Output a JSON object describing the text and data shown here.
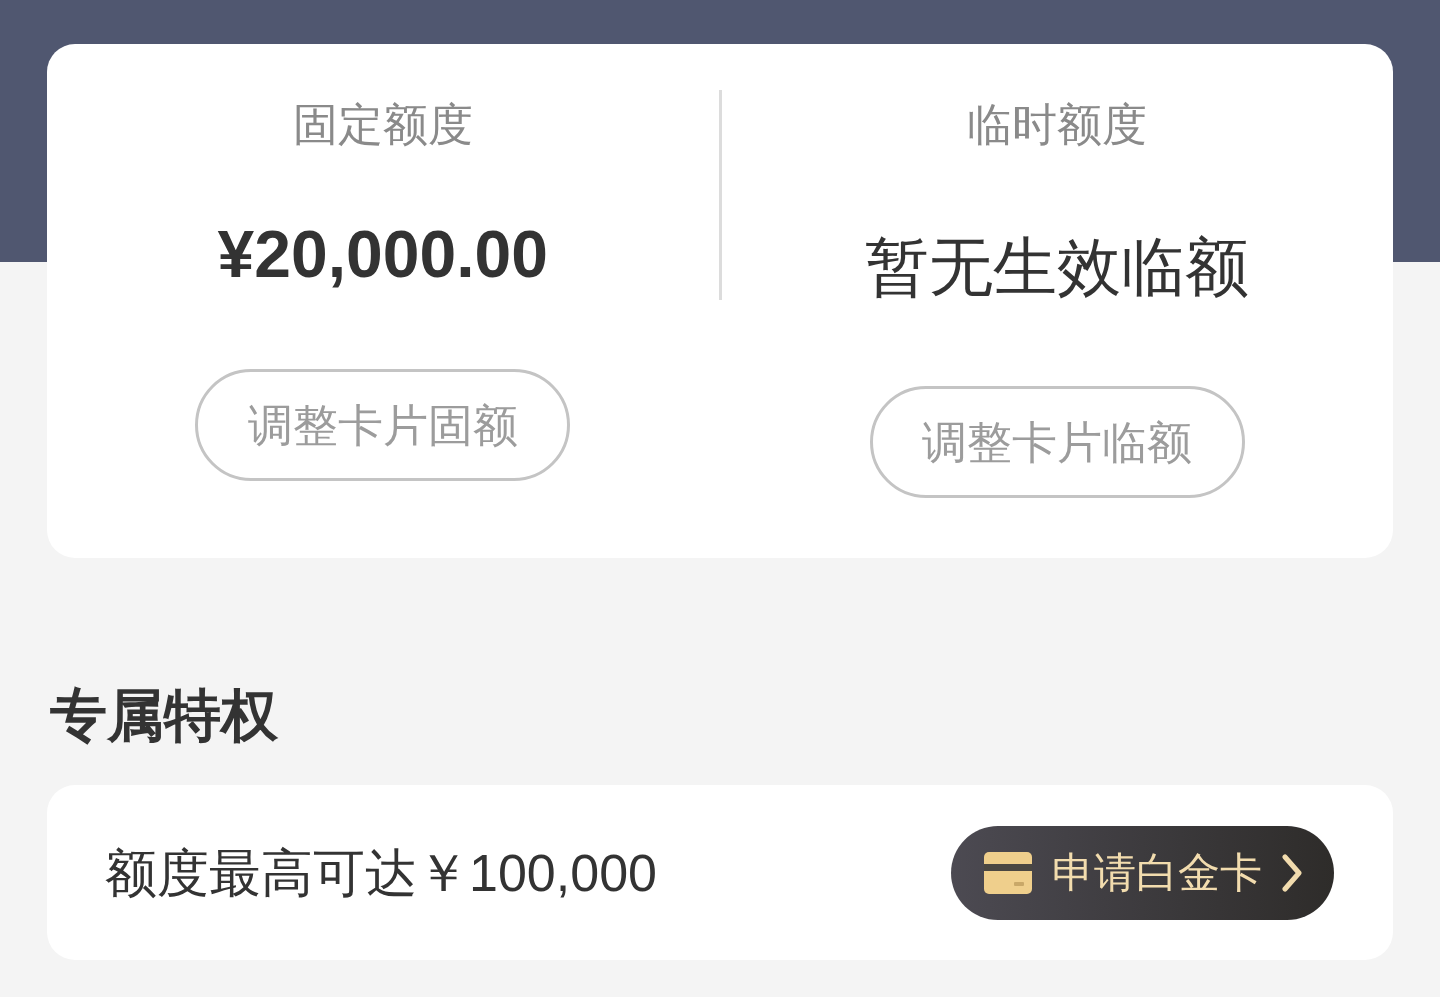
{
  "limits": [
    {
      "title": "固定额度",
      "kind": "amount",
      "value": "¥20,000.00",
      "button": "调整卡片固额"
    },
    {
      "title": "临时额度",
      "kind": "status",
      "value": "暂无生效临额",
      "button": "调整卡片临额"
    }
  ],
  "privileges": {
    "heading": "专属特权",
    "items": [
      {
        "text": "额度最高可达￥100,000",
        "button": "申请白金卡"
      }
    ]
  }
}
